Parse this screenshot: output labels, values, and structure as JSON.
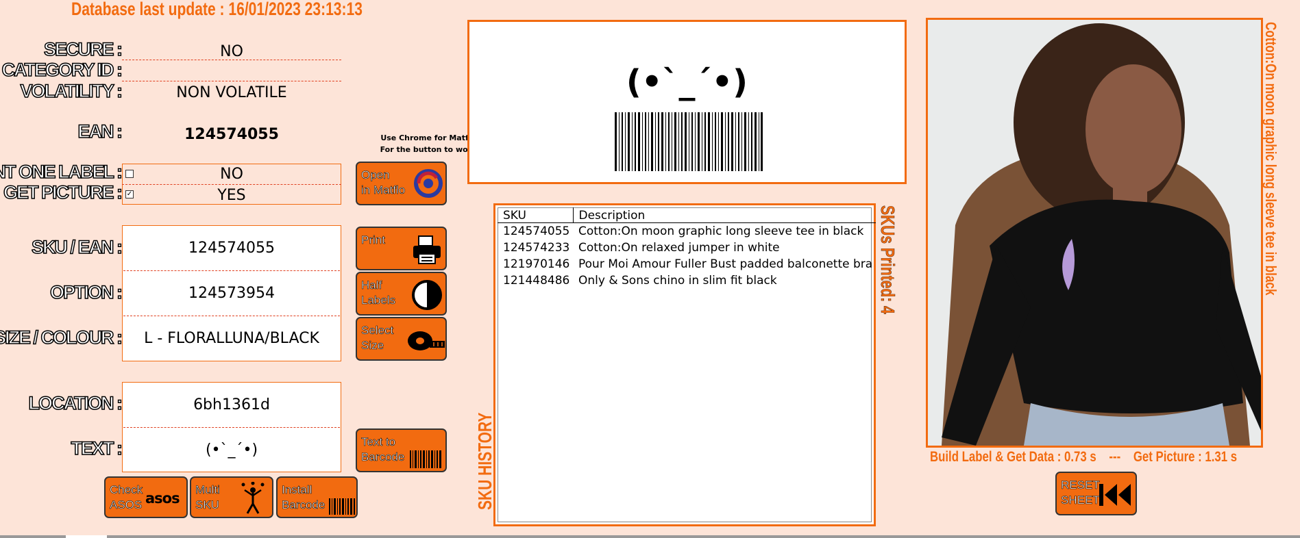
{
  "header": {
    "db_update": "Database last update : 16/01/2023 23:13:13"
  },
  "fields": {
    "secure": {
      "label": "SECURE :",
      "value": "NO"
    },
    "category": {
      "label": "CATEGORY ID :",
      "value": ""
    },
    "volatility": {
      "label": "VOLATILITY :",
      "value": "NON VOLATILE"
    },
    "ean": {
      "label": "EAN :",
      "value": "124574055"
    },
    "print_one": {
      "label": "PRINT ONE LABEL :",
      "value": "NO",
      "checked": false
    },
    "get_picture": {
      "label": "GET PICTURE :",
      "value": "YES",
      "checked": true
    },
    "sku_ean": {
      "label": "SKU / EAN :",
      "value": "124574055"
    },
    "option": {
      "label": "OPTION :",
      "value": "124573954"
    },
    "size_colour": {
      "label": "SIZE / COLOUR :",
      "value": "L - FLORALLUNA/BLACK"
    },
    "location": {
      "label": "LOCATION :",
      "value": "6bh1361d"
    },
    "text": {
      "label": "TEXT :",
      "value": "(•`_´•)"
    }
  },
  "chrome_note": {
    "line1": "Use Chrome for Matflo",
    "line2": "For the button to work"
  },
  "buttons": {
    "open_matflo": "Open\nin Matflo",
    "print": "Print",
    "half_labels": "Half\nLabels",
    "select_size": "Select\nSize",
    "text_to_barcode": "Text to\nBarcode",
    "check_asos": "Check\nASOS",
    "asos_logo": "asos",
    "multi_sku": "Multi\nSKU",
    "install_barcode": "Install\nBarcode",
    "reset_sheet": "RESET\nSHEET"
  },
  "preview": {
    "text": "(•`_´•)"
  },
  "history": {
    "title": "SKU HISTORY",
    "printed": "SKUs Printed: 4",
    "columns": [
      "SKU",
      "Description"
    ],
    "rows": [
      {
        "sku": "124574055",
        "desc": "Cotton:On moon graphic long sleeve tee in black"
      },
      {
        "sku": "124574233",
        "desc": "Cotton:On relaxed jumper in white"
      },
      {
        "sku": "121970146",
        "desc": "Pour Moi Amour Fuller Bust padded balconette bra in"
      },
      {
        "sku": "121448486",
        "desc": "Only & Sons chino in slim fit black"
      }
    ]
  },
  "product": {
    "title": "Cotton:On moon graphic long sleeve tee in black",
    "timing": "Build Label & Get Data : 0.73 s    ---    Get Picture : 1.31 s"
  },
  "colors": {
    "accent": "#f26b10",
    "background": "#fde4d8"
  }
}
